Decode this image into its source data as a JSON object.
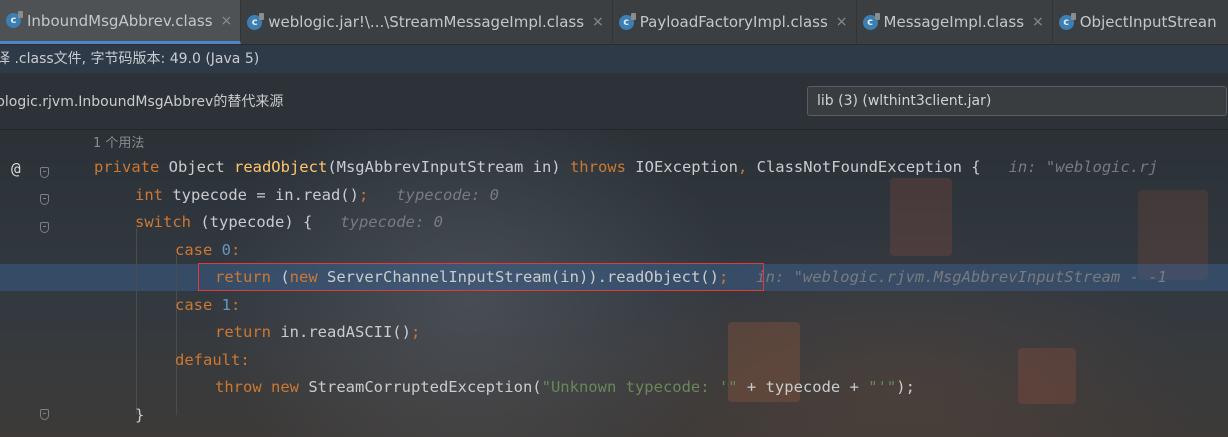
{
  "tabs": [
    {
      "label": "InboundMsgAbbrev.class",
      "active": true,
      "close": "×"
    },
    {
      "label": "weblogic.jar!\\...\\StreamMessageImpl.class",
      "active": false,
      "close": "×"
    },
    {
      "label": "PayloadFactoryImpl.class",
      "active": false,
      "close": "×"
    },
    {
      "label": "MessageImpl.class",
      "active": false,
      "close": "×"
    },
    {
      "label": "ObjectInputStrean",
      "active": false,
      "close": ""
    }
  ],
  "icons": {
    "class_file": "class-file-icon",
    "implements": "at-override-icon",
    "fold": "fold-icon"
  },
  "info": {
    "class_version": "译 .class文件, 字节码版本: 49.0 (Java 5)",
    "alt_source": "blogic.rjvm.InboundMsgAbbrev的替代来源",
    "library": "lib (3) (wlthint3client.jar)"
  },
  "editor": {
    "usage_hint": "1 个用法",
    "lines": [
      {
        "segments": [
          {
            "t": "private ",
            "c": "kw"
          },
          {
            "t": "Object ",
            "c": "plain"
          },
          {
            "t": "readObject",
            "c": "fn"
          },
          {
            "t": "(MsgAbbrevInputStream in) ",
            "c": "plain"
          },
          {
            "t": "throws ",
            "c": "kw"
          },
          {
            "t": "IOException",
            "c": "plain"
          },
          {
            "t": ", ",
            "c": "kw"
          },
          {
            "t": "ClassNotFoundException {",
            "c": "plain"
          },
          {
            "t": "   in: \"weblogic.rj",
            "c": "hint"
          }
        ]
      },
      {
        "segments": [
          {
            "t": "int ",
            "c": "kw"
          },
          {
            "t": "typecode = in.read()",
            "c": "plain"
          },
          {
            "t": ";",
            "c": "kw"
          },
          {
            "t": "   typecode: 0",
            "c": "hint"
          }
        ]
      },
      {
        "segments": [
          {
            "t": "switch ",
            "c": "kw"
          },
          {
            "t": "(typecode) {",
            "c": "plain"
          },
          {
            "t": "   typecode: 0",
            "c": "hint"
          }
        ]
      },
      {
        "segments": [
          {
            "t": "case ",
            "c": "kw"
          },
          {
            "t": "0",
            "c": "num"
          },
          {
            "t": ":",
            "c": "kw"
          }
        ]
      },
      {
        "segments": [
          {
            "t": "return ",
            "c": "kw"
          },
          {
            "t": "(",
            "c": "plain"
          },
          {
            "t": "new ",
            "c": "kw"
          },
          {
            "t": "ServerChannelInputStream(in)).readObject()",
            "c": "plain"
          },
          {
            "t": ";",
            "c": "kw"
          },
          {
            "t": "   in: \"weblogic.rjvm.MsgAbbrevInputStream - -1",
            "c": "hint"
          }
        ]
      },
      {
        "segments": [
          {
            "t": "case ",
            "c": "kw"
          },
          {
            "t": "1",
            "c": "num"
          },
          {
            "t": ":",
            "c": "kw"
          }
        ]
      },
      {
        "segments": [
          {
            "t": "return ",
            "c": "kw"
          },
          {
            "t": "in.readASCII()",
            "c": "plain"
          },
          {
            "t": ";",
            "c": "kw"
          }
        ]
      },
      {
        "segments": [
          {
            "t": "default",
            "c": "kw"
          },
          {
            "t": ":",
            "c": "kw"
          }
        ]
      },
      {
        "segments": [
          {
            "t": "throw ",
            "c": "kw"
          },
          {
            "t": "new ",
            "c": "kw"
          },
          {
            "t": "StreamCorruptedException(",
            "c": "plain"
          },
          {
            "t": "\"Unknown typecode: '\"",
            "c": "str"
          },
          {
            "t": " + typecode + ",
            "c": "plain"
          },
          {
            "t": "\"'\"",
            "c": "str"
          },
          {
            "t": ");",
            "c": "plain"
          }
        ]
      },
      {
        "segments": [
          {
            "t": "}",
            "c": "plain"
          }
        ]
      }
    ],
    "highlighted_line": 4
  },
  "colors": {
    "keyword": "#cc7832",
    "method": "#ffc66d",
    "string": "#6a8759",
    "number": "#6897bb",
    "hint": "#787b80",
    "highlight_box": "#e03a3a"
  }
}
